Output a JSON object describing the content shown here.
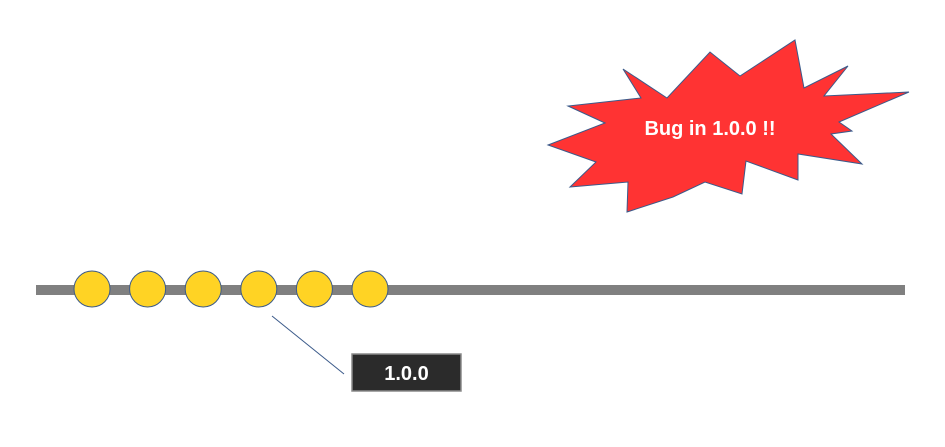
{
  "colors": {
    "background": "#ffffff",
    "timeline": "#808080",
    "commit_fill": "#ffd324",
    "commit_stroke": "#3b5a8a",
    "callout_line": "#3b5a8a",
    "tag_fill": "#2b2b2b",
    "tag_border": "#8a8a8a",
    "burst_fill": "#ff3333",
    "burst_stroke": "#3b5a8a",
    "text_light": "#ffffff"
  },
  "timeline": {
    "commit_count": 6,
    "tagged_commit_index": 3
  },
  "tag": {
    "label": "1.0.0"
  },
  "alert": {
    "shape": "explosion-burst",
    "label": "Bug in 1.0.0 !!"
  }
}
